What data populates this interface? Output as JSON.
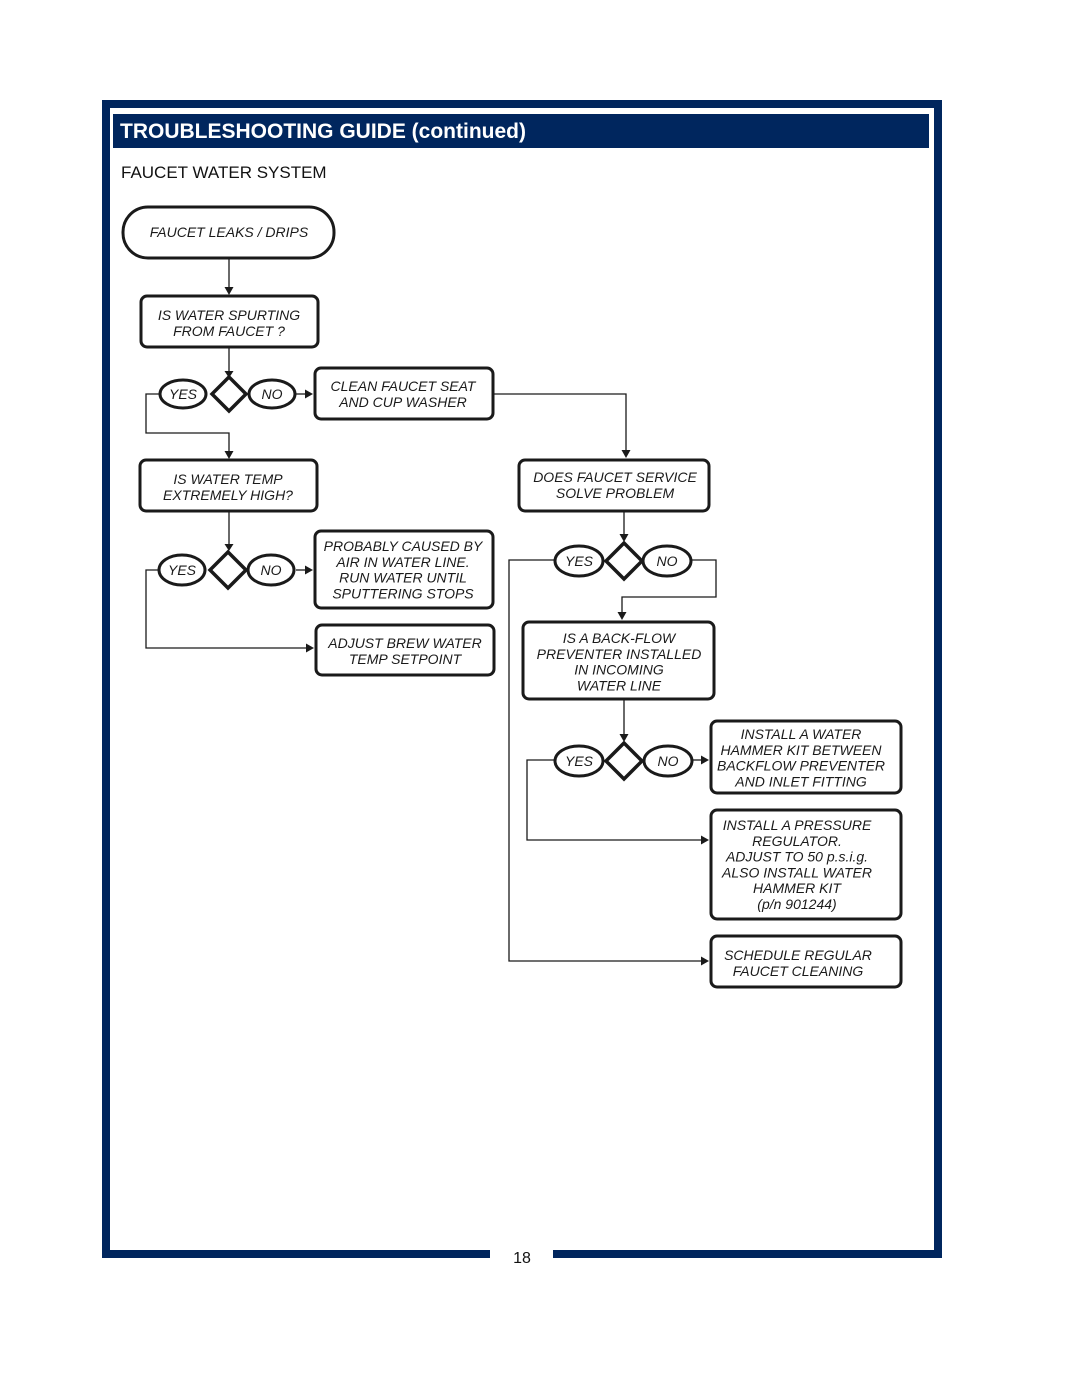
{
  "header": {
    "title": "TROUBLESHOOTING GUIDE (continued)"
  },
  "section": {
    "title": "FAUCET WATER SYSTEM"
  },
  "footer": {
    "page_number": "18"
  },
  "flowchart": {
    "start": {
      "lines": [
        "FAUCET LEAKS / DRIPS"
      ]
    },
    "nodes": {
      "q_spurting": {
        "lines": [
          "IS WATER SPURTING",
          "FROM FAUCET ?"
        ]
      },
      "clean_seat": {
        "lines": [
          "CLEAN FAUCET SEAT",
          "AND CUP WASHER"
        ]
      },
      "q_temp": {
        "lines": [
          "IS WATER TEMP",
          "EXTREMELY HIGH?"
        ]
      },
      "air_in_line": {
        "lines": [
          "PROBABLY CAUSED BY",
          "AIR IN WATER LINE.",
          "RUN WATER UNTIL",
          "SPUTTERING STOPS"
        ]
      },
      "adjust_temp": {
        "lines": [
          "ADJUST BREW WATER",
          "TEMP SETPOINT"
        ]
      },
      "q_service": {
        "lines": [
          "DOES FAUCET SERVICE",
          "SOLVE PROBLEM"
        ]
      },
      "q_backflow": {
        "lines": [
          "IS A BACK-FLOW",
          "PREVENTER INSTALLED",
          "IN INCOMING",
          "WATER LINE"
        ]
      },
      "hammer_kit": {
        "lines": [
          "INSTALL A WATER",
          "HAMMER KIT BETWEEN",
          "BACKFLOW PREVENTER",
          "AND INLET FITTING"
        ]
      },
      "pressure_reg": {
        "lines": [
          "INSTALL A PRESSURE",
          "REGULATOR.",
          "ADJUST TO 50 p.s.i.g.",
          "ALSO INSTALL WATER",
          "HAMMER KIT",
          "(p/n 901244)"
        ]
      },
      "schedule_clean": {
        "lines": [
          "SCHEDULE REGULAR",
          "FAUCET CLEANING"
        ]
      }
    },
    "labels": {
      "yes": "YES",
      "no": "NO"
    }
  }
}
